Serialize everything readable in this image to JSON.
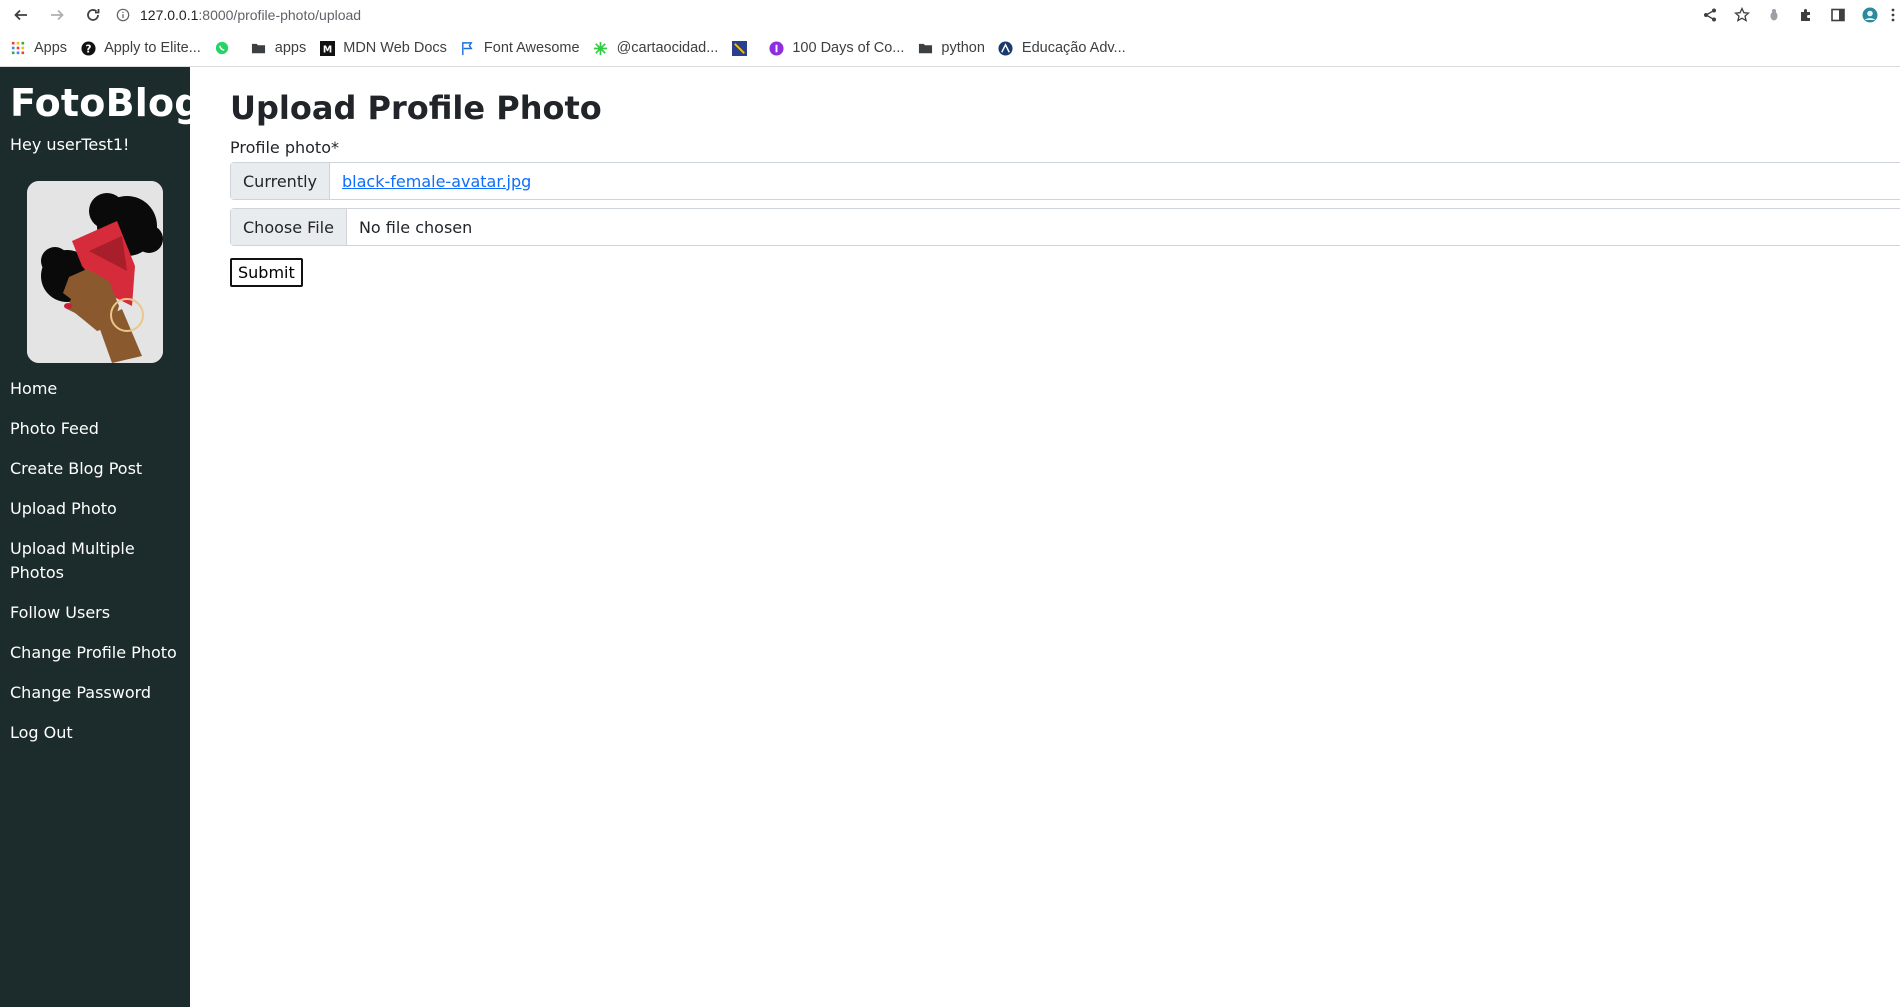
{
  "browser": {
    "url_host": "127.0.0.1",
    "url_path": ":8000/profile-photo/upload",
    "bookmarks": [
      {
        "label": "Apps",
        "icon": "apps-grid-icon"
      },
      {
        "label": "Apply to Elite...",
        "icon": "question-circle-icon"
      },
      {
        "label": "",
        "icon": "whatsapp-icon"
      },
      {
        "label": "apps",
        "icon": "folder-icon"
      },
      {
        "label": "MDN Web Docs",
        "icon": "mdn-icon"
      },
      {
        "label": "Font Awesome",
        "icon": "flag-icon"
      },
      {
        "label": "@cartaocidad...",
        "icon": "sparkle-icon"
      },
      {
        "label": "",
        "icon": "blue-square-icon"
      },
      {
        "label": "100 Days of Co...",
        "icon": "purple-circle-icon"
      },
      {
        "label": "python",
        "icon": "folder-icon"
      },
      {
        "label": "Educação Adv...",
        "icon": "globe-icon"
      }
    ]
  },
  "sidebar": {
    "brand": "FotoBlog",
    "greeting": "Hey userTest1!",
    "menu": [
      "Home",
      "Photo Feed",
      "Create Blog Post",
      "Upload Photo",
      "Upload Multiple Photos",
      "Follow Users",
      "Change Profile Photo",
      "Change Password",
      "Log Out"
    ]
  },
  "main": {
    "title": "Upload Profile Photo",
    "field_label": "Profile photo*",
    "currently_label": "Currently",
    "current_file": "black-female-avatar.jpg",
    "choose_file_label": "Choose File",
    "no_file_text": "No file chosen",
    "submit_label": "Submit"
  },
  "colors": {
    "sidebar_bg": "#1c2b2b",
    "link": "#0d6efd",
    "addon_bg": "#e9ecef"
  }
}
